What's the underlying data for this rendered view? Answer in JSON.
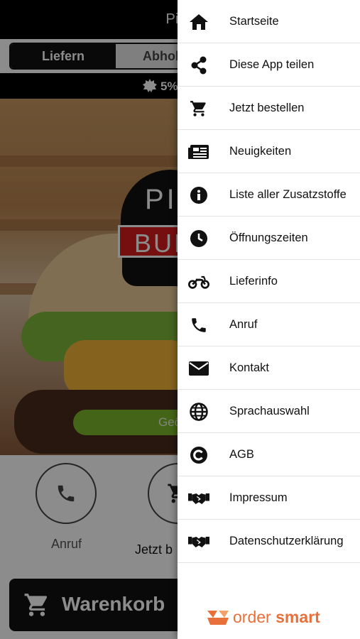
{
  "app": {
    "title": "Pit´s",
    "toggle": {
      "delivery": "Liefern",
      "pickup": "Abholen"
    },
    "promo_text": "5%",
    "hero_logo_top": "PIT",
    "hero_logo_mid": "BUR",
    "hero_button": "Geö",
    "actions": {
      "call": "Anruf",
      "order": "Jetzt b"
    },
    "cart_label": "Warenkorb"
  },
  "drawer": {
    "items": [
      {
        "label": "Startseite",
        "icon": "home-icon"
      },
      {
        "label": "Diese App teilen",
        "icon": "share-icon"
      },
      {
        "label": "Jetzt bestellen",
        "icon": "cart-icon"
      },
      {
        "label": "Neuigkeiten",
        "icon": "newspaper-icon"
      },
      {
        "label": "Liste aller Zusatzstoffe",
        "icon": "info-icon"
      },
      {
        "label": "Öffnungszeiten",
        "icon": "clock-icon"
      },
      {
        "label": "Lieferinfo",
        "icon": "motorcycle-icon"
      },
      {
        "label": "Anruf",
        "icon": "phone-icon"
      },
      {
        "label": "Kontakt",
        "icon": "envelope-icon"
      },
      {
        "label": "Sprachauswahl",
        "icon": "globe-icon"
      },
      {
        "label": "AGB",
        "icon": "copyright-icon"
      },
      {
        "label": "Impressum",
        "icon": "handshake-icon"
      },
      {
        "label": "Datenschutzerklärung",
        "icon": "handshake-icon"
      }
    ],
    "brand": {
      "part1": "order",
      "part2": "smart"
    }
  },
  "colors": {
    "accent_green": "#7cb62b",
    "brand_orange": "#e8703a",
    "logo_red": "#d81c1c"
  }
}
